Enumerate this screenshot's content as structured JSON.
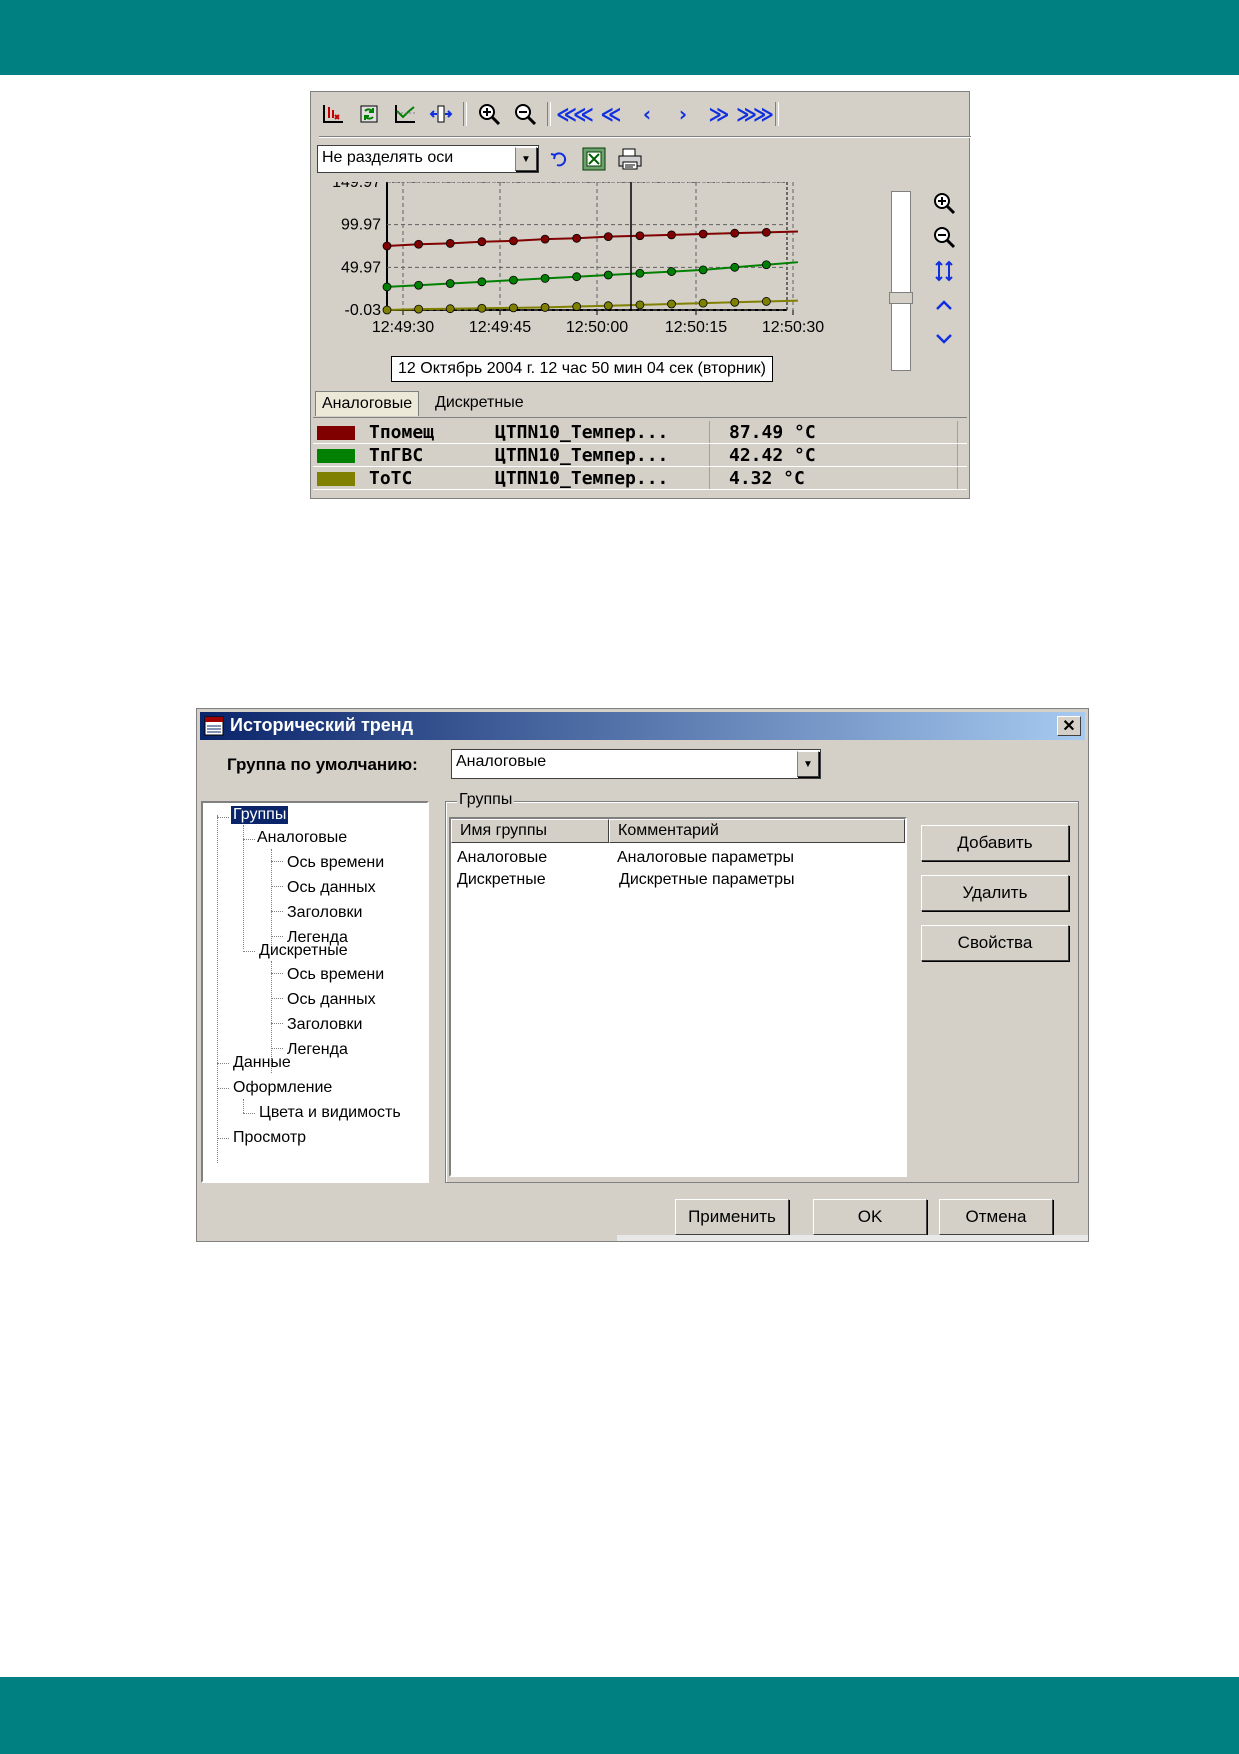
{
  "trend": {
    "toolbar_icons": [
      "axis-marker-icon",
      "refresh-icon",
      "chart-line-icon",
      "cursor-split-icon",
      "zoom-in-icon",
      "zoom-out-icon"
    ],
    "nav": [
      "≪≪",
      "≪",
      "‹",
      "›",
      "≫",
      "≫≫"
    ],
    "axes_mode": "Не разделять оси",
    "tooltip": "12 Октябрь 2004 г. 12 час 50 мин 04 сек (вторник)",
    "tabs": [
      "Аналоговые",
      "Дискретные"
    ],
    "legend": [
      {
        "name": "Tпомещ",
        "desc": "ЦТПN10_Темпер...",
        "value": "87.49 °C",
        "color": "#800000"
      },
      {
        "name": "TпГВС",
        "desc": "ЦТПN10_Темпер...",
        "value": "42.42 °C",
        "color": "#008000"
      },
      {
        "name": "ToTC",
        "desc": "ЦТПN10_Темпер...",
        "value": "4.32 °C",
        "color": "#808000"
      }
    ]
  },
  "chart_data": {
    "type": "line",
    "x_ticks": [
      "12:49:30",
      "12:49:45",
      "12:50:00",
      "12:50:15",
      "12:50:30"
    ],
    "y_ticks": [
      "149.97",
      "99.97",
      "49.97",
      "-0.03"
    ],
    "ylim": [
      -0.03,
      149.97
    ],
    "cursor_time": "12:50:04",
    "series": [
      {
        "color": "#800000",
        "points": [
          [
            0,
            75
          ],
          [
            1,
            77
          ],
          [
            2,
            78
          ],
          [
            3,
            80
          ],
          [
            4,
            81
          ],
          [
            5,
            83
          ],
          [
            6,
            84
          ],
          [
            7,
            86
          ],
          [
            8,
            87
          ],
          [
            9,
            88
          ],
          [
            10,
            89
          ],
          [
            11,
            90
          ],
          [
            12,
            91
          ],
          [
            13,
            92
          ],
          [
            14,
            93
          ],
          [
            15,
            94
          ]
        ]
      },
      {
        "color": "#008000",
        "points": [
          [
            0,
            27
          ],
          [
            1,
            29
          ],
          [
            2,
            31
          ],
          [
            3,
            33
          ],
          [
            4,
            35
          ],
          [
            5,
            37
          ],
          [
            6,
            39
          ],
          [
            7,
            41
          ],
          [
            8,
            43
          ],
          [
            9,
            45
          ],
          [
            10,
            47
          ],
          [
            11,
            50
          ],
          [
            12,
            53
          ],
          [
            13,
            56
          ],
          [
            14,
            58
          ],
          [
            15,
            61
          ]
        ]
      },
      {
        "color": "#808000",
        "points": [
          [
            0,
            0
          ],
          [
            1,
            1
          ],
          [
            2,
            1.5
          ],
          [
            3,
            2
          ],
          [
            4,
            2.5
          ],
          [
            5,
            3
          ],
          [
            6,
            4
          ],
          [
            7,
            5
          ],
          [
            8,
            6
          ],
          [
            9,
            7
          ],
          [
            10,
            8
          ],
          [
            11,
            9
          ],
          [
            12,
            10
          ],
          [
            13,
            11
          ],
          [
            14,
            13
          ],
          [
            15,
            15
          ]
        ]
      }
    ]
  },
  "dialog": {
    "title": "Исторический тренд",
    "default_group_label": "Группа по умолчанию:",
    "default_group_value": "Аналоговые",
    "tree": {
      "root": "Группы",
      "analog": "Аналоговые",
      "discrete": "Дискретные",
      "children": [
        "Ось времени",
        "Ось данных",
        "Заголовки",
        "Легенда"
      ],
      "data": "Данные",
      "design": "Оформление",
      "colors": "Цвета и видимость",
      "view": "Просмотр"
    },
    "groups_title": "Группы",
    "columns": [
      "Имя группы",
      "Комментарий"
    ],
    "rows": [
      {
        "name": "Аналоговые",
        "comment": "Аналоговые параметры"
      },
      {
        "name": "Дискретные",
        "comment": "Дискретные параметры"
      }
    ],
    "buttons": {
      "add": "Добавить",
      "delete": "Удалить",
      "props": "Свойства",
      "apply": "Применить",
      "ok": "OK",
      "cancel": "Отмена"
    }
  }
}
